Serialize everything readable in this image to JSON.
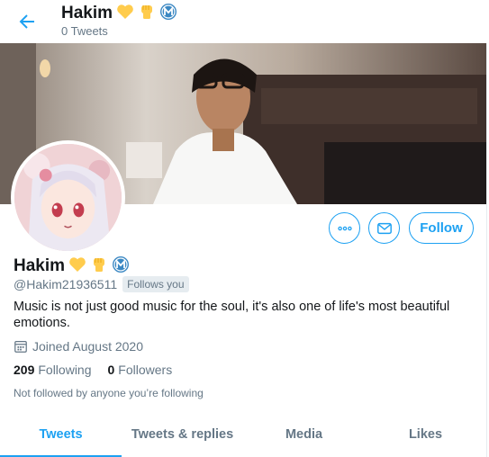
{
  "header": {
    "name": "Hakim",
    "tweet_count": "0 Tweets",
    "back_icon": "arrow-left-icon"
  },
  "profile": {
    "name": "Hakim",
    "handle": "@Hakim21936511",
    "follows_you": "Follows you",
    "bio": "Music is not just good music for the soul, it's also one of life's most beautiful emotions.",
    "joined": "Joined August 2020",
    "following_count": "209",
    "following_label": "Following",
    "followers_count": "0",
    "followers_label": "Followers",
    "not_followed": "Not followed by anyone you’re following"
  },
  "actions": {
    "more_icon": "more-icon",
    "message_icon": "envelope-icon",
    "follow_label": "Follow"
  },
  "tabs": [
    {
      "label": "Tweets",
      "active": true
    },
    {
      "label": "Tweets & replies",
      "active": false
    },
    {
      "label": "Media",
      "active": false
    },
    {
      "label": "Likes",
      "active": false
    }
  ],
  "colors": {
    "accent": "#1da1f2",
    "secondary_text": "#657786",
    "heart": "#ffcc4d",
    "badge_blue": "#3b88c3"
  }
}
